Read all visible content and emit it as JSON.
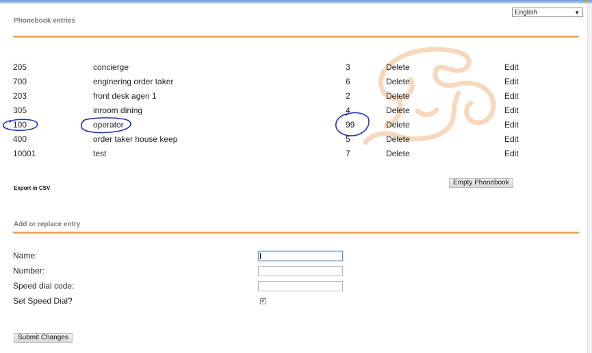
{
  "language": {
    "selected": "English"
  },
  "phonebook": {
    "title": "Phonebook entries",
    "entries": [
      {
        "number": "205",
        "name": "concierge",
        "speed_dial": "3",
        "delete": "Delete",
        "edit": "Edit"
      },
      {
        "number": "700",
        "name": "enginering order taker",
        "speed_dial": "6",
        "delete": "Delete",
        "edit": "Edit"
      },
      {
        "number": "203",
        "name": "front desk agen 1",
        "speed_dial": "2",
        "delete": "Delete",
        "edit": "Edit"
      },
      {
        "number": "305",
        "name": "inroom dining",
        "speed_dial": "4",
        "delete": "Delete",
        "edit": "Edit"
      },
      {
        "number": "100",
        "name": "operator",
        "speed_dial": "99",
        "delete": "Delete",
        "edit": "Edit"
      },
      {
        "number": "400",
        "name": "order taker house keep",
        "speed_dial": "5",
        "delete": "Delete",
        "edit": "Edit"
      },
      {
        "number": "10001",
        "name": "test",
        "speed_dial": "7",
        "delete": "Delete",
        "edit": "Edit"
      }
    ],
    "export_label": "Export in CSV",
    "empty_button": "Empty Phonebook"
  },
  "add_entry": {
    "title": "Add or replace entry",
    "name_label": "Name:",
    "number_label": "Number:",
    "speed_dial_label": "Speed dial code:",
    "set_speed_dial_label": "Set Speed Dial?",
    "set_speed_dial_checked": true,
    "name_value": "",
    "number_value": "",
    "speed_dial_value": "",
    "submit_button": "Submit Changes"
  },
  "colors": {
    "accent_rule": "#e68a2e",
    "annotation_ink": "#1a2fb8",
    "watermark": "#f6d9bd"
  }
}
